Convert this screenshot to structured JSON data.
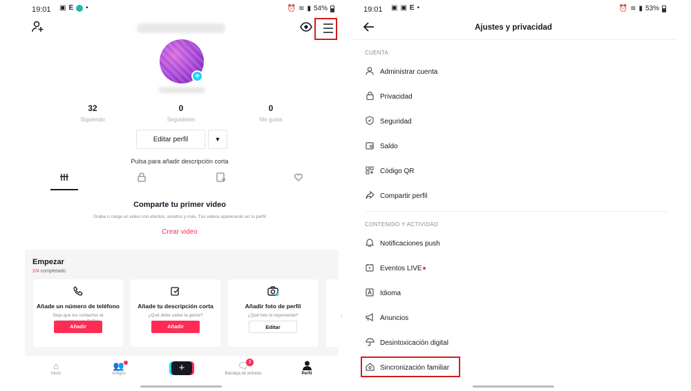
{
  "left": {
    "status": {
      "time": "19:01",
      "battery": "54%"
    },
    "stats": [
      {
        "value": "32",
        "label": "Siguiendo"
      },
      {
        "value": "0",
        "label": "Seguidores"
      },
      {
        "value": "0",
        "label": "Me gusta"
      }
    ],
    "edit_profile": "Editar perfil",
    "dropdown_icon": "▼",
    "bio_placeholder": "Pulsa para añadir descripción corta",
    "empty": {
      "title": "Comparte tu primer video",
      "subtitle": "Graba o carga un video con efectos, sonidos y más. Tus videos aparecerán en tu perfil",
      "cta": "Crear video"
    },
    "start": {
      "title": "Empezar",
      "progress_done": "2/4",
      "progress_text": " completado",
      "cards": [
        {
          "icon": "phone-icon",
          "title": "Añade un número de teléfono",
          "desc": "Deja que tus contactos te encuentren en TikTok",
          "button": "Añadir"
        },
        {
          "icon": "edit-icon",
          "title": "Añade tu descripción corta",
          "desc": "¿Qué debe saber la gente?",
          "button": "Añadir"
        },
        {
          "icon": "camera-icon",
          "title": "Añadir foto de perfil",
          "desc": "¿Qué foto te representa?",
          "button": "Editar"
        }
      ]
    },
    "nav": {
      "home": "Inicio",
      "friends": "Amigos",
      "inbox": "Bandeja de entrada",
      "inbox_badge": "3",
      "profile": "Perfil"
    }
  },
  "right": {
    "status": {
      "time": "19:01",
      "battery": "53%"
    },
    "title": "Ajustes y privacidad",
    "section_account": "CUENTA",
    "account_items": [
      {
        "icon": "user-icon",
        "label": "Administrar cuenta"
      },
      {
        "icon": "lock-icon",
        "label": "Privacidad"
      },
      {
        "icon": "shield-icon",
        "label": "Seguridad"
      },
      {
        "icon": "wallet-icon",
        "label": "Saldo"
      },
      {
        "icon": "qr-icon",
        "label": "Código QR"
      },
      {
        "icon": "share-icon",
        "label": "Compartir perfil"
      }
    ],
    "section_content": "CONTENIDO Y ACTIVIDAD",
    "content_items": [
      {
        "icon": "bell-icon",
        "label": "Notificaciones push"
      },
      {
        "icon": "live-icon",
        "label": "Eventos LIVE"
      },
      {
        "icon": "language-icon",
        "label": "Idioma"
      },
      {
        "icon": "megaphone-icon",
        "label": "Anuncios"
      },
      {
        "icon": "umbrella-icon",
        "label": "Desintoxicación digital"
      },
      {
        "icon": "family-icon",
        "label": "Sincronización familiar"
      }
    ],
    "highlight_color": "#d21a1a",
    "accent_color": "#fe2c55"
  }
}
